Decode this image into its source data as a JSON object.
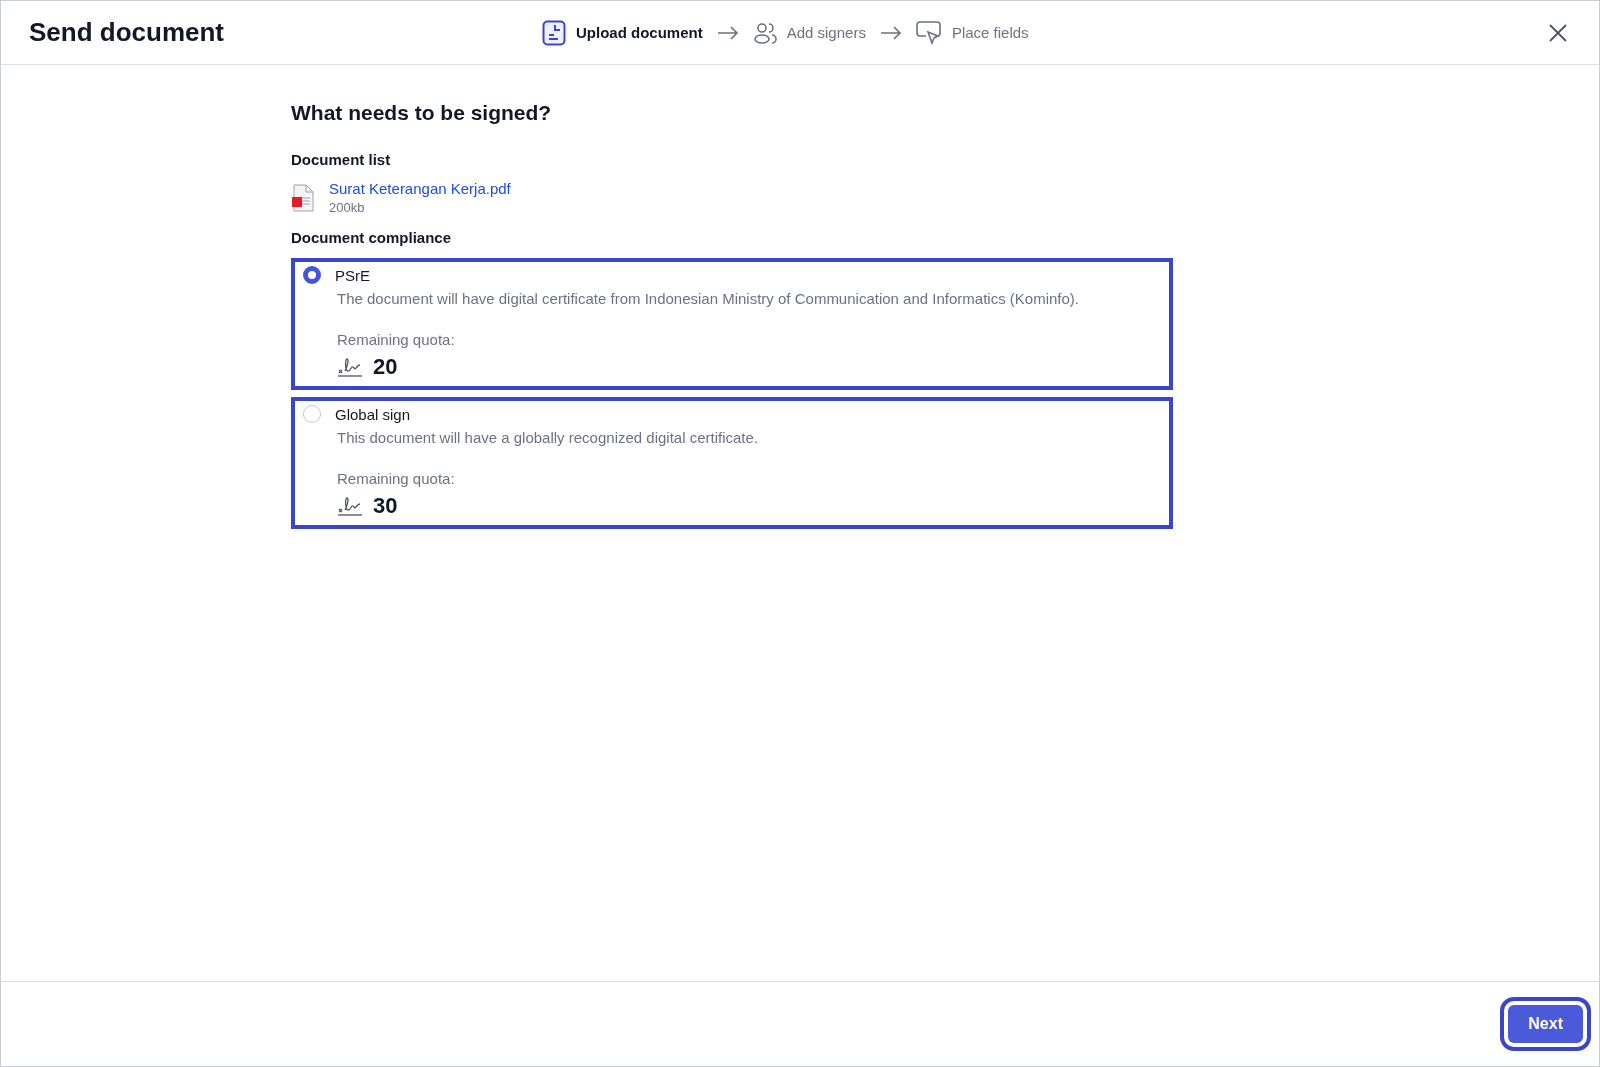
{
  "header": {
    "title": "Send document",
    "steps": [
      {
        "kind": "document",
        "label": "Upload document",
        "selected": true
      },
      {
        "kind": "signers",
        "label": "Add signers",
        "selected": false
      },
      {
        "kind": "fields",
        "label": "Place fields",
        "selected": false
      }
    ]
  },
  "main": {
    "heading": "What needs to be signed?",
    "document_list_label": "Document list",
    "documents": [
      {
        "name": "Surat Keterangan Kerja.pdf",
        "size": "200kb"
      }
    ],
    "compliance_label": "Document compliance",
    "options": [
      {
        "title": "PSrE",
        "description": "The document will have digital certificate from Indonesian Ministry of Communication and Informatics (Kominfo).",
        "quota_label": "Remaining quota:",
        "quota": "20",
        "selected": true
      },
      {
        "title": "Global sign",
        "description": "This document will have a globally recognized digital certificate.",
        "quota_label": "Remaining quota:",
        "quota": "30",
        "selected": false
      }
    ]
  },
  "footer": {
    "button": "Next"
  }
}
